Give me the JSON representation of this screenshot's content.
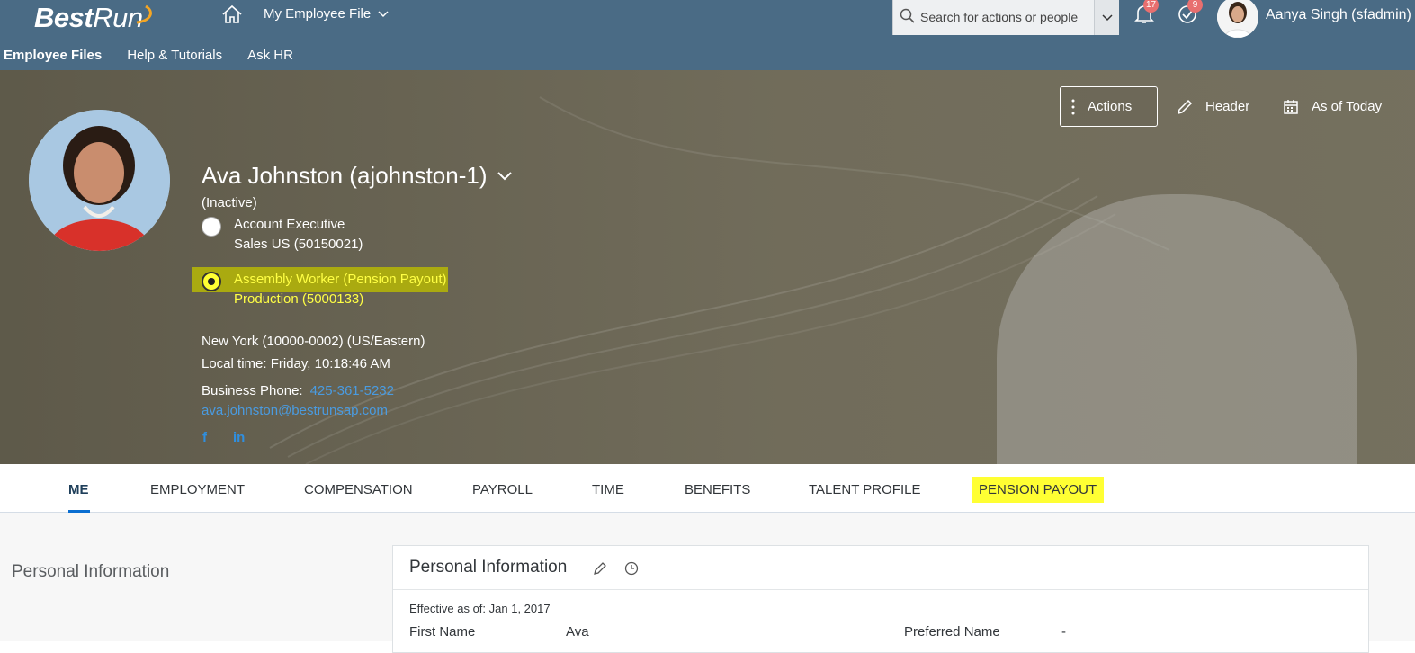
{
  "shell": {
    "logo": {
      "best": "Best",
      "run": "Run"
    },
    "app_menu_label": "My Employee File",
    "search_placeholder": "Search for actions or people",
    "notifications_count": "17",
    "todo_count": "9",
    "user_name": "Aanya Singh (sfadmin)"
  },
  "subnav": {
    "items": [
      "Employee Files",
      "Help & Tutorials",
      "Ask HR"
    ]
  },
  "header_actions": {
    "actions_label": "Actions",
    "header_label": "Header",
    "asof_label": "As of Today"
  },
  "employee": {
    "name": "Ava Johnston (ajohnston-1)",
    "status": "(Inactive)",
    "job1_title": "Account Executive",
    "job1_dept": "Sales US (50150021)",
    "job2_title": "Assembly Worker (Pension Payout)",
    "job2_dept": "Production (5000133)",
    "location": "New York (10000-0002) (US/Eastern)",
    "local_time": "Local time: Friday, 10:18:46 AM",
    "phone_label": "Business Phone:",
    "phone": "425-361-5232",
    "email": "ava.johnston@bestrunsap.com",
    "social_fb": "f",
    "social_li": "in"
  },
  "tabs": [
    "ME",
    "EMPLOYMENT",
    "COMPENSATION",
    "PAYROLL",
    "TIME",
    "BENEFITS",
    "TALENT PROFILE",
    "PENSION PAYOUT"
  ],
  "section": {
    "left_title": "Personal Information",
    "card_title": "Personal Information",
    "effective": "Effective as of: Jan 1, 2017",
    "first_name_label": "First Name",
    "first_name_value": "Ava",
    "preferred_name_label": "Preferred Name",
    "preferred_name_value": "-"
  },
  "colors": {
    "shell": "#4a6b85",
    "highlight": "#ffff33",
    "link": "#4a9be0",
    "accent": "#0a6ed1"
  }
}
